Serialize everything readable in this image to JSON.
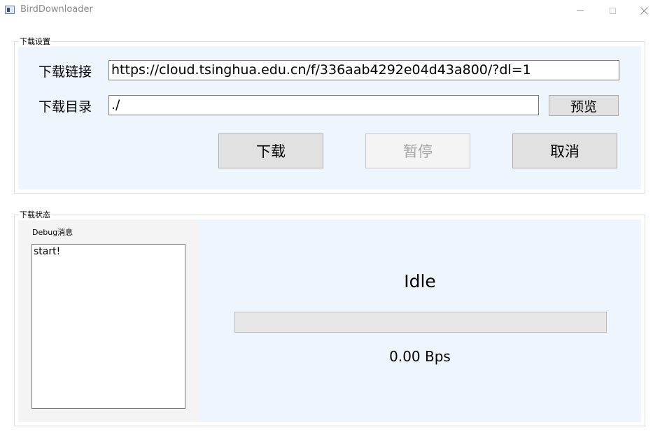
{
  "window": {
    "title": "BirdDownloader"
  },
  "settings": {
    "group_title": "下载设置",
    "url_label": "下载链接",
    "url_value": "https://cloud.tsinghua.edu.cn/f/336aab4292e04d43a800/?dl=1",
    "dir_label": "下载目录",
    "dir_value": "./",
    "browse_label": "预览",
    "download_label": "下载",
    "pause_label": "暂停",
    "pause_enabled": false,
    "cancel_label": "取消"
  },
  "status": {
    "group_title": "下载状态",
    "debug_label": "Debug消息",
    "debug_text": "start!",
    "state": "Idle",
    "progress": 0,
    "speed": "0.00 Bps"
  },
  "colors": {
    "panel_blue": "#eef5fd",
    "debug_panel": "#f4f4f4",
    "progress_fill": "#06b025"
  },
  "icons": {
    "app": "app-icon",
    "minimize": "minimize-icon",
    "maximize": "maximize-icon",
    "close": "close-icon"
  }
}
